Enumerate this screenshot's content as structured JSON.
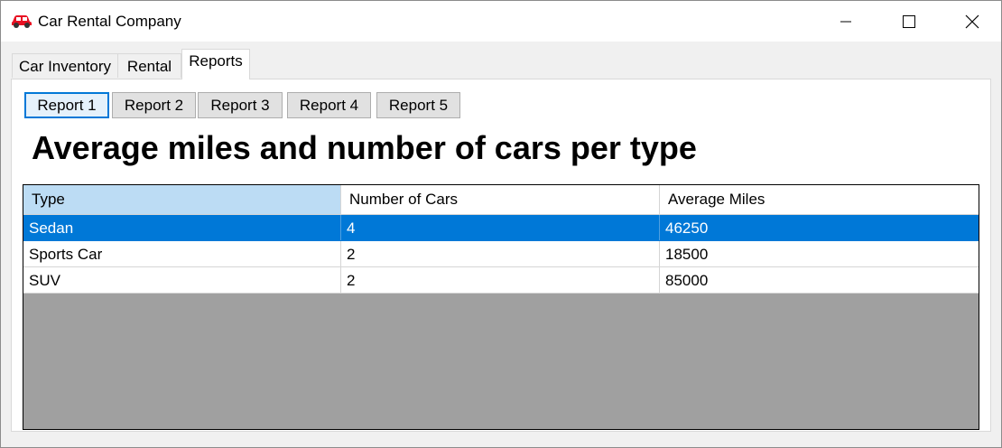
{
  "window": {
    "title": "Car Rental Company",
    "app_icon": "car-icon",
    "controls": [
      "minimize-icon",
      "maximize-icon",
      "close-icon"
    ]
  },
  "tabs": [
    {
      "label": "Car Inventory",
      "selected": false
    },
    {
      "label": "Rental",
      "selected": false
    },
    {
      "label": "Reports",
      "selected": true
    }
  ],
  "report_buttons": [
    {
      "label": "Report 1",
      "focused": true
    },
    {
      "label": "Report 2",
      "focused": false
    },
    {
      "label": "Report 3",
      "focused": false
    },
    {
      "label": "Report 4",
      "focused": false
    },
    {
      "label": "Report 5",
      "focused": false
    }
  ],
  "report_title": "Average miles and number of cars per type",
  "grid": {
    "columns": [
      "Type",
      "Number of Cars",
      "Average Miles"
    ],
    "rows": [
      {
        "type": "Sedan",
        "count": "4",
        "avg_miles": "46250",
        "selected": true
      },
      {
        "type": "Sports Car",
        "count": "2",
        "avg_miles": "18500",
        "selected": false
      },
      {
        "type": "SUV",
        "count": "2",
        "avg_miles": "85000",
        "selected": false
      }
    ]
  },
  "colors": {
    "selection": "#0078d7",
    "header_highlight": "#bcdcf4",
    "grid_background": "#a0a0a0",
    "app_icon": "#e81123"
  }
}
